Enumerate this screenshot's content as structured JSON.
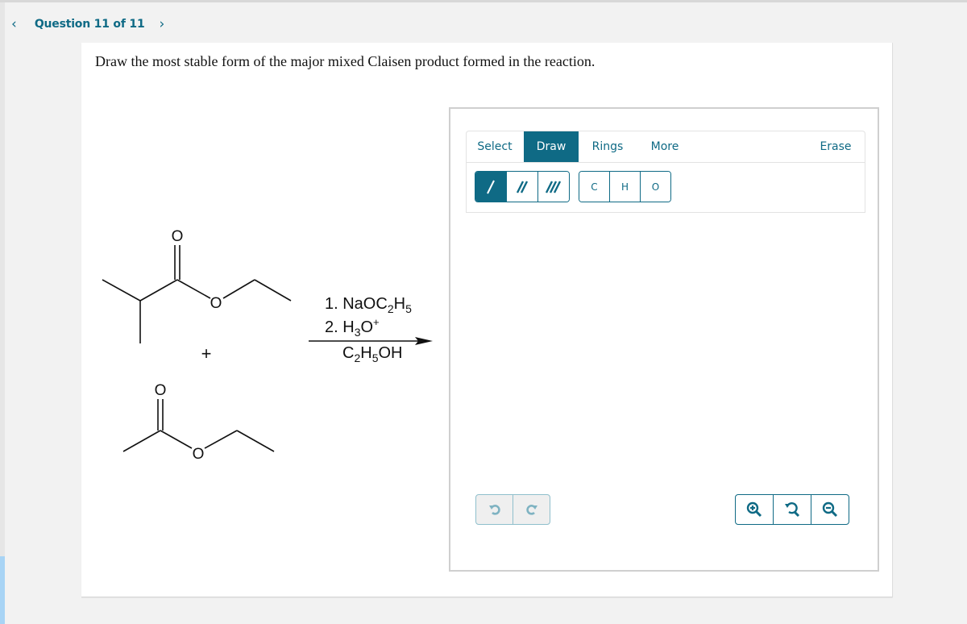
{
  "nav": {
    "prev_icon": "chevron-left-icon",
    "title": "Question 11 of 11",
    "next_icon": "chevron-right-icon"
  },
  "question": {
    "prompt": "Draw the most stable form of the major mixed Claisen product formed in the reaction."
  },
  "reaction": {
    "reactant_1": {
      "name": "ethyl 2-methylpropanoate",
      "atom_labels": [
        "O",
        "O"
      ]
    },
    "plus_sign": "+",
    "reactant_2": {
      "name": "ethyl acetate",
      "atom_labels": [
        "O",
        "O"
      ]
    },
    "conditions": {
      "step_1": {
        "prefix": "1. NaOC",
        "sub1": "2",
        "mid": "H",
        "sub2": "5"
      },
      "step_2": {
        "prefix": "2. H",
        "sub1": "3",
        "mid": "O",
        "sup": "+"
      },
      "solvent": {
        "prefix": "C",
        "sub1": "2",
        "mid": "H",
        "sub2": "5",
        "suffix": "OH"
      }
    }
  },
  "editor": {
    "tabs": [
      {
        "label": "Select",
        "active": false
      },
      {
        "label": "Draw",
        "active": true
      },
      {
        "label": "Rings",
        "active": false
      },
      {
        "label": "More",
        "active": false
      }
    ],
    "erase_label": "Erase",
    "bond_tools": [
      {
        "name": "single-bond",
        "active": true
      },
      {
        "name": "double-bond",
        "active": false
      },
      {
        "name": "triple-bond",
        "active": false
      }
    ],
    "atom_tools": [
      "C",
      "H",
      "O"
    ],
    "undo_icon": "undo-icon",
    "redo_icon": "redo-icon",
    "zoom_in_icon": "zoom-in-icon",
    "reset_zoom_icon": "reset-zoom-icon",
    "zoom_out_icon": "zoom-out-icon",
    "accent_color": "#0f6a85"
  }
}
